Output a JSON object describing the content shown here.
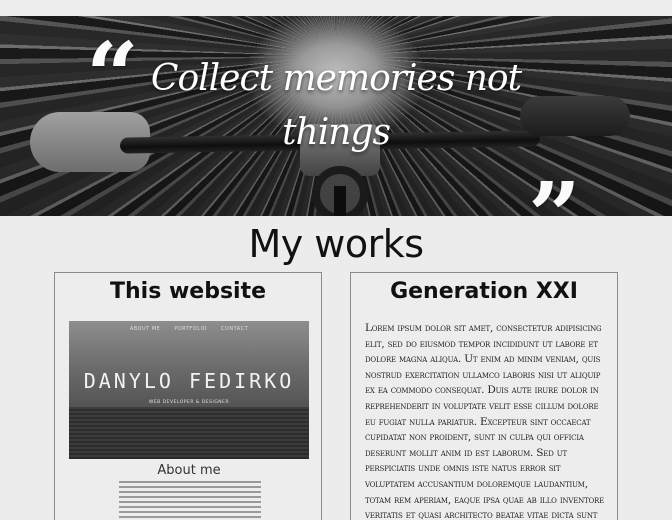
{
  "hero": {
    "open_quote": "“",
    "close_quote": "”",
    "quote_text": "Collect memories not things"
  },
  "section": {
    "title": "My works"
  },
  "works": [
    {
      "title": "This website",
      "preview": {
        "nav": [
          "ABOUT ME",
          "PORTFOLIO",
          "CONTACT"
        ],
        "name": "DANYLO FEDIRKO",
        "subtitle": "WEB DEVELOPER & DESIGNER"
      },
      "about_heading": "About me"
    },
    {
      "title": "Generation XXI",
      "description": "Lorem ipsum dolor sit amet, consectetur adipisicing elit, sed do eiusmod tempor incididunt ut labore et dolore magna aliqua. Ut enim ad minim veniam, quis nostrud exercitation ullamco laboris nisi ut aliquip ex ea commodo consequat. Duis aute irure dolor in reprehenderit in voluptate velit esse cillum dolore eu fugiat nulla pariatur. Excepteur sint occaecat cupidatat non proident, sunt in culpa qui officia deserunt mollit anim id est laborum. Sed ut perspiciatis unde omnis iste natus error sit voluptatem accusantium doloremque laudantium, totam rem aperiam, eaque ipsa quae ab illo inventore veritatis et quasi architecto beatae vitae dicta sunt explicabo. Nemo enim"
    }
  ]
}
